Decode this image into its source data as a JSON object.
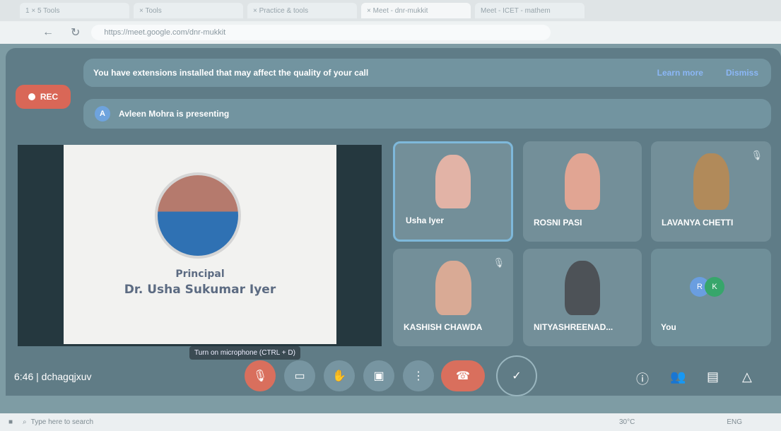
{
  "browser": {
    "tabs": [
      {
        "label": "1 × 5 Tools"
      },
      {
        "label": "× Tools"
      },
      {
        "label": "× Practice & tools"
      },
      {
        "label": "× Meet - dnr-mukkit"
      },
      {
        "label": "Meet - ICET - mathem"
      }
    ],
    "address": "https://meet.google.com/dnr-mukkit"
  },
  "meet": {
    "recording_label": "REC",
    "extension_banner": "You have extensions installed that may affect the quality of your call",
    "learn_more": "Learn more",
    "dismiss": "Dismiss",
    "presenter_badge": "A",
    "presenter_text": "Avleen Mohra is presenting",
    "slide": {
      "title": "Principal",
      "subtitle": "Dr. Usha Sukumar Iyer"
    },
    "participants": [
      {
        "name": "Usha Iyer"
      },
      {
        "name": "ROSNI PASI"
      },
      {
        "name": "LAVANYA CHETTI"
      },
      {
        "name": "KASHISH CHAWDA"
      },
      {
        "name": "NITYASHREENAD..."
      }
    ],
    "self_tile": {
      "initials": [
        "R",
        "K"
      ],
      "label": "You"
    },
    "tooltip": "Turn on microphone (CTRL + D)",
    "time": "6:46",
    "meeting_code": "dchagqjxuv"
  },
  "taskbar": {
    "search_placeholder": "Type here to search",
    "weather": "30°C",
    "language": "ENG"
  }
}
